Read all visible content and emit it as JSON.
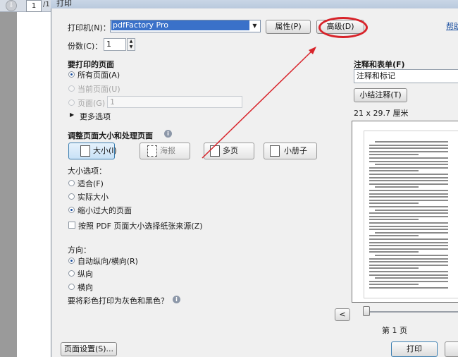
{
  "background_app": {
    "page_current": "1",
    "page_separator": "/",
    "page_total": "1"
  },
  "dialog": {
    "title": "打印",
    "printer_label": "打印机(N)：",
    "printer_value": "pdfFactory Pro",
    "properties_button": "属性(P)",
    "advanced_button": "高级(D)",
    "help_link": "帮助",
    "copies_label": "份数(C)：",
    "copies_value": "1",
    "pages_section": {
      "title": "要打印的页面",
      "all_pages": "所有页面(A)",
      "current_page": "当前页面(U)",
      "pages_label": "页面(G)",
      "pages_value": "1",
      "more_options": "更多选项"
    },
    "size_section": {
      "title": "调整页面大小和处理页面",
      "buttons": [
        "大小(I)",
        "海报",
        "多页",
        "小册子"
      ],
      "size_options_label": "大小选项：",
      "fit": "适合(F)",
      "actual_size": "实际大小",
      "shrink": "缩小过大的页面",
      "choose_paper": "按照 PDF 页面大小选择纸张来源(Z)"
    },
    "orientation_section": {
      "title": "方向：",
      "auto": "自动纵向/横向(R)",
      "portrait": "纵向",
      "landscape": "横向",
      "grayscale_question": "要将彩色打印为灰色和黑色？"
    },
    "annotations": {
      "title": "注释和表单(F)",
      "select_value": "注释和标记",
      "summarize_button": "小结注释(T)",
      "paper_size": "21 x 29.7 厘米"
    },
    "preview": {
      "page_label": "第 1 页",
      "prev_button": "<"
    },
    "page_setup_button": "页面设置(S)...",
    "print_button": "打印"
  },
  "accent_colors": {
    "annotation_circle": "#d8232a",
    "selection_blue": "#3a71c9"
  }
}
